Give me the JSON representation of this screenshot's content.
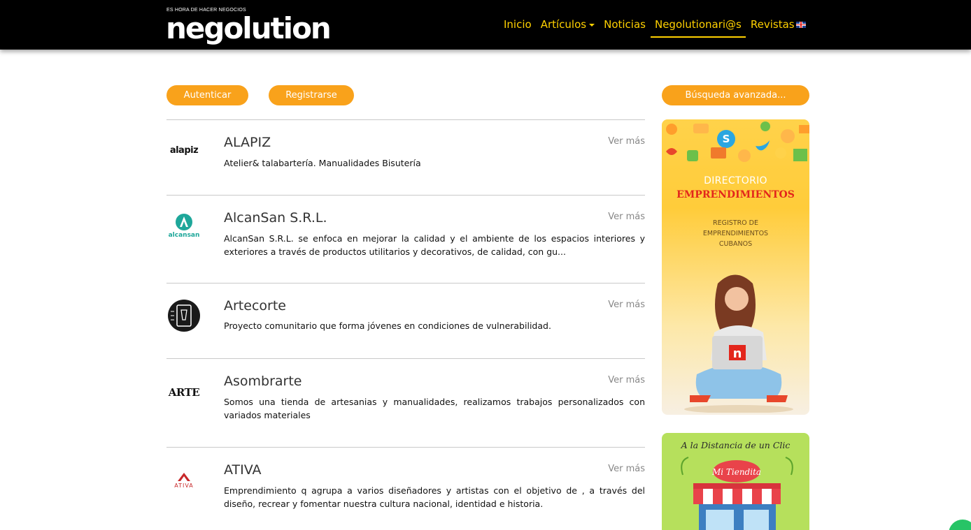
{
  "header": {
    "logo_tagline": "ES HORA DE HACER NEGOCIOS",
    "logo_text": "negolution",
    "nav": [
      {
        "label": "Inicio"
      },
      {
        "label": "Artículos"
      },
      {
        "label": "Noticias"
      },
      {
        "label": "Negolutionari@s"
      },
      {
        "label": "Revistas"
      }
    ],
    "active_nav": "Negolutionari@s",
    "language_icon": "uk-flag-icon"
  },
  "actions": {
    "login": "Autenticar",
    "register": "Registrarse",
    "advanced_search": "Búsqueda avanzada..."
  },
  "entries": [
    {
      "logo_text": "alapiz",
      "title": "ALAPIZ",
      "more": "Ver más",
      "description": "Atelier& talabartería. Manualidades Bisutería"
    },
    {
      "logo_text": "alcansan",
      "title": "AlcanSan S.R.L.",
      "more": "Ver más",
      "description": "AlcanSan S.R.L. se enfoca en mejorar la calidad y el ambiente de los espacios interiores y exteriores a través de productos utilitarios y decorativos, de calidad, con gu..."
    },
    {
      "logo_text": "",
      "title": "Artecorte",
      "more": "Ver más",
      "description": "Proyecto comunitario que forma jóvenes en condiciones de vulnerabilidad."
    },
    {
      "logo_text": "ARTE",
      "title": "Asombrarte",
      "more": "Ver más",
      "description": "Somos una tienda de artesanias y manualidades, realizamos trabajos personalizados con variados materiales"
    },
    {
      "logo_text": "ATIVA",
      "title": "ATIVA",
      "more": "Ver más",
      "description": "Emprendimiento q agrupa a varios diseñadores y artistas con el objetivo de , a través del diseño, recrear y fomentar nuestra cultura nacional, identidad e historia."
    }
  ],
  "sidebar": {
    "banner1": {
      "line1": "DIRECTORIO",
      "line2": "EMPRENDIMIENTOS",
      "sub": [
        "REGISTRO DE",
        "EMPRENDIMIENTOS",
        "CUBANOS"
      ],
      "laptop_logo": "n"
    },
    "banner2": {
      "title": "A la Distancia de un Clic",
      "shop_sign": "Mi Tiendita"
    }
  },
  "colors": {
    "header_bg": "#000000",
    "nav_text": "#ffd100",
    "accent_orange": "#f9a21b",
    "divider": "#c9c9c9"
  }
}
